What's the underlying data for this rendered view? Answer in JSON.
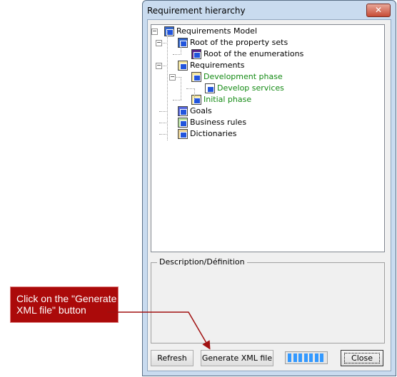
{
  "window": {
    "title": "Requirement hierarchy",
    "close_icon": "close-icon"
  },
  "tree": {
    "items": [
      {
        "label": "Requirements Model",
        "level": 0,
        "expanded": true,
        "icon": "model-icon",
        "color": "#000000"
      },
      {
        "label": "Root of the property sets",
        "level": 1,
        "expanded": true,
        "icon": "property-sets-icon",
        "color": "#000000"
      },
      {
        "label": "Root of the enumerations",
        "level": 2,
        "icon": "enumerations-icon",
        "color": "#000000"
      },
      {
        "label": "Requirements",
        "level": 1,
        "expanded": true,
        "icon": "requirements-folder-icon",
        "color": "#000000"
      },
      {
        "label": "Development phase",
        "level": 2,
        "expanded": true,
        "icon": "requirements-folder-icon",
        "color": "#138a13"
      },
      {
        "label": "Develop services",
        "level": 3,
        "icon": "requirement-document-icon",
        "color": "#138a13"
      },
      {
        "label": "Initial phase",
        "level": 2,
        "icon": "requirements-folder-icon",
        "color": "#138a13"
      },
      {
        "label": "Goals",
        "level": 1,
        "icon": "goals-folder-icon",
        "color": "#000000"
      },
      {
        "label": "Business rules",
        "level": 1,
        "icon": "business-rules-folder-icon",
        "color": "#000000"
      },
      {
        "label": "Dictionaries",
        "level": 1,
        "icon": "dictionaries-icon",
        "color": "#000000"
      }
    ]
  },
  "description": {
    "label": "Description/Définition"
  },
  "buttons": {
    "refresh": "Refresh",
    "generate": "Generate XML file",
    "close": "Close"
  },
  "progress": {
    "segments_filled": 7,
    "color": "#3399ff"
  },
  "callout": {
    "text": "Click on the \"Generate XML file\" button",
    "color": "#ab0a0a"
  }
}
